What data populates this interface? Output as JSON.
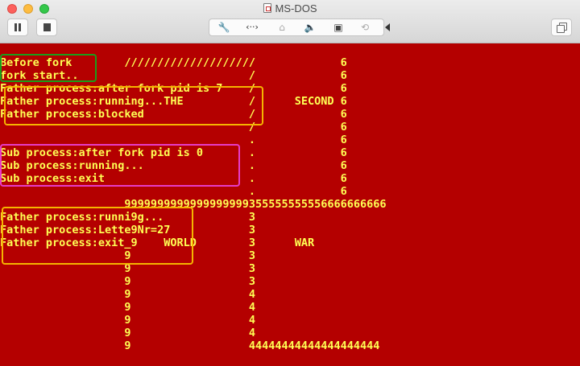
{
  "window": {
    "title": "MS-DOS",
    "icons": [
      "document-icon",
      "pause-icon",
      "stop-icon",
      "wrench-icon",
      "network-icon",
      "disk-icon",
      "speaker-icon",
      "save-icon",
      "sync-icon",
      "collapse-arrow-icon",
      "window-icon"
    ],
    "colors": {
      "screen_bg": "#b40000",
      "text": "#ffff54",
      "green_box": "#1a9e1a",
      "yellow_box": "#f5b400",
      "magenta_box": "#e63cc8"
    }
  },
  "console": {
    "lines": [
      "Before fork        ////////////////////             6",
      "fork start..                          /             6",
      "Father process:after fork pid is 7    /             6",
      "Father process:running...THE          /      SECOND 6",
      "Father process:blocked                /             6",
      "                                      /             6",
      "                                      .             6",
      "Sub process:after fork pid is 0       .             6",
      "Sub process:running...                .             6",
      "Sub process:exit                      .             6",
      "                                      .             6",
      "                   9999999999999999999355555555556666666666",
      "Father process:runni9g...             3",
      "Father process:Lette9Nr=27            3",
      "Father process:exit_9    WORLD        3      WAR",
      "                   9                  3",
      "                   9                  3",
      "                   9                  3",
      "                   9                  4",
      "                   9                  4",
      "                   9                  4",
      "                   9                  4",
      "                   9                  44444444444444444444"
    ]
  }
}
